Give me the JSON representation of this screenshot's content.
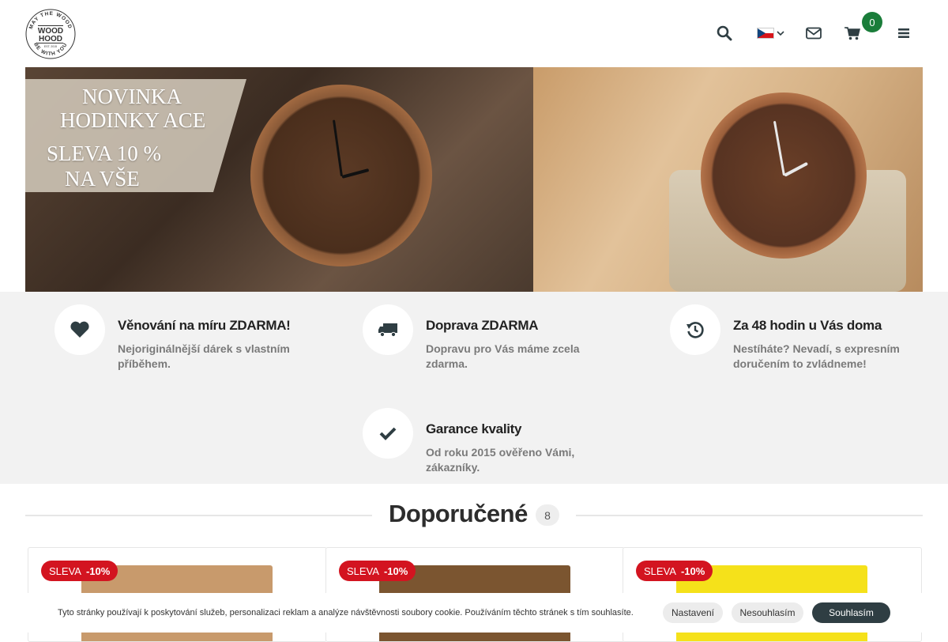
{
  "header": {
    "logo_alt": "WOOD HOOD",
    "logo_lines": [
      "MAY THE WOOD",
      "WOOD",
      "HOOD",
      "EST. 2015",
      "BE WITH YOU"
    ],
    "icons": [
      "search-icon",
      "flag-cz-icon",
      "chevron-down-icon",
      "envelope-icon",
      "cart-icon",
      "menu-icon"
    ],
    "cart_count": "0",
    "accent_color": "#1a7d3a"
  },
  "hero": {
    "line1": "NOVINKA",
    "line2": "HODINKY ACE",
    "line3": "SLEVA 10 %",
    "line4": "NA VŠE",
    "watch_text": "Wood Hood"
  },
  "features": [
    {
      "icon": "heart-icon",
      "title": "Věnování na míru ZDARMA!",
      "desc": "Nejoriginálnější dárek s vlastním příběhem."
    },
    {
      "icon": "truck-icon",
      "title": "Doprava ZDARMA",
      "desc": "Dopravu pro Vás máme zcela zdarma."
    },
    {
      "icon": "history-icon",
      "title": "Za 48 hodin u Vás doma",
      "desc": "Nestíháte? Nevadí, s expresním doručením to zvládneme!"
    },
    {
      "icon": "check-icon",
      "title": "Garance kvality",
      "desc": "Od roku 2015 ověřeno Vámi, zákazníky."
    }
  ],
  "section": {
    "title": "Doporučené",
    "count": "8"
  },
  "products": [
    {
      "badge_label": "SLEVA",
      "badge_value": "-10%",
      "img_color": "#c89a6c"
    },
    {
      "badge_label": "SLEVA",
      "badge_value": "-10%",
      "img_color": "#7b5530"
    },
    {
      "badge_label": "SLEVA",
      "badge_value": "-10%",
      "img_color": "#f5e11a"
    }
  ],
  "cookie": {
    "text": "Tyto stránky používají k poskytování služeb, personalizaci reklam a analýze návštěvnosti soubory cookie. Používáním těchto stránek s tím souhlasíte.",
    "settings_label": "Nastavení",
    "decline_label": "Nesouhlasím",
    "accept_label": "Souhlasím"
  },
  "colors": {
    "sale_badge": "#d31420",
    "features_bg": "#f2f2f2",
    "accept_button": "#2f3e43"
  }
}
